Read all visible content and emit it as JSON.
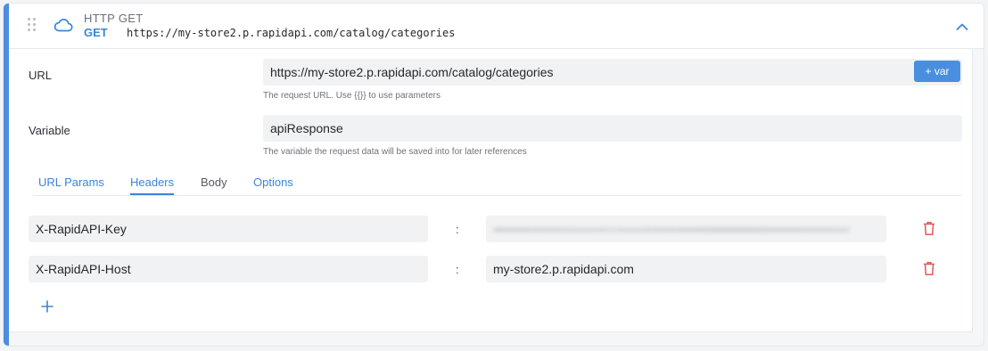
{
  "header": {
    "step_title": "HTTP GET",
    "method": "GET",
    "url": "https://my-store2.p.rapidapi.com/catalog/categories"
  },
  "fields": {
    "url_label": "URL",
    "url_value": "https://my-store2.p.rapidapi.com/catalog/categories",
    "url_hint": "The request URL. Use {{}} to use parameters",
    "var_button": "+ var",
    "variable_label": "Variable",
    "variable_value": "apiResponse",
    "variable_hint": "The variable the request data will be saved into for later references"
  },
  "tabs": [
    {
      "label": "URL Params"
    },
    {
      "label": "Headers"
    },
    {
      "label": "Body"
    },
    {
      "label": "Options"
    }
  ],
  "active_tab": "Headers",
  "headers": [
    {
      "key": "X-RapidAPI-Key",
      "separator": ":",
      "value": ""
    },
    {
      "key": "X-RapidAPI-Host",
      "separator": ":",
      "value": "my-store2.p.rapidapi.com"
    }
  ],
  "icons": {
    "drag": "drag-handle-icon",
    "cloud": "cloud-icon",
    "collapse": "chevron-up-icon",
    "delete": "trash-icon",
    "add": "plus-icon"
  },
  "colors": {
    "accent": "#4a8fdf",
    "danger": "#e05a5a"
  }
}
